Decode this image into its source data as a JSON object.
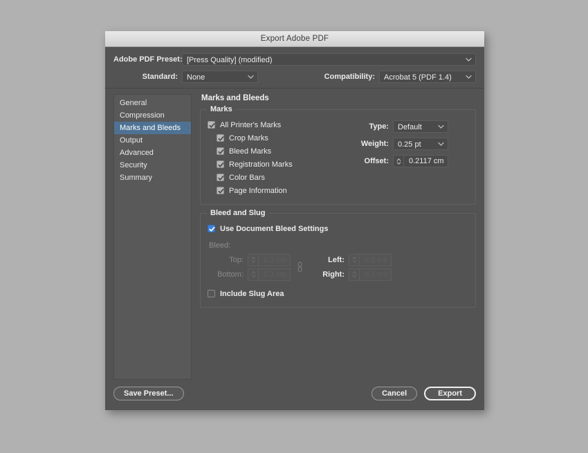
{
  "window": {
    "title": "Export Adobe PDF"
  },
  "top": {
    "preset_label": "Adobe PDF Preset:",
    "preset_value": "[Press Quality] (modified)",
    "standard_label": "Standard:",
    "standard_value": "None",
    "compatibility_label": "Compatibility:",
    "compatibility_value": "Acrobat 5 (PDF 1.4)"
  },
  "sidebar": {
    "items": [
      {
        "label": "General",
        "selected": false
      },
      {
        "label": "Compression",
        "selected": false
      },
      {
        "label": "Marks and Bleeds",
        "selected": true
      },
      {
        "label": "Output",
        "selected": false
      },
      {
        "label": "Advanced",
        "selected": false
      },
      {
        "label": "Security",
        "selected": false
      },
      {
        "label": "Summary",
        "selected": false
      }
    ]
  },
  "pane": {
    "title": "Marks and Bleeds",
    "marks": {
      "group_label": "Marks",
      "all_printers_marks": {
        "label": "All Printer's Marks",
        "checked": true
      },
      "items": [
        {
          "label": "Crop Marks",
          "checked": true
        },
        {
          "label": "Bleed Marks",
          "checked": true
        },
        {
          "label": "Registration Marks",
          "checked": true
        },
        {
          "label": "Color Bars",
          "checked": true
        },
        {
          "label": "Page Information",
          "checked": true
        }
      ],
      "type_label": "Type:",
      "type_value": "Default",
      "weight_label": "Weight:",
      "weight_value": "0.25 pt",
      "offset_label": "Offset:",
      "offset_value": "0.2117 cm"
    },
    "bleed_slug": {
      "group_label": "Bleed and Slug",
      "use_doc_bleed": {
        "label": "Use Document Bleed Settings",
        "checked": true
      },
      "bleed_label": "Bleed:",
      "top_label": "Top:",
      "top_value": "0.3 cm",
      "bottom_label": "Bottom:",
      "bottom_value": "0.3 cm",
      "left_label": "Left:",
      "left_value": "0.3 cm",
      "right_label": "Right:",
      "right_value": "0.3 cm",
      "include_slug": {
        "label": "Include Slug Area",
        "checked": false
      }
    }
  },
  "footer": {
    "save_preset": "Save Preset...",
    "cancel": "Cancel",
    "export": "Export"
  },
  "colors": {
    "dialog_bg": "#535353",
    "selection_blue": "#4e7294",
    "checkbox_blue": "#3b82d9",
    "desktop_bg": "#b1b1b1"
  }
}
